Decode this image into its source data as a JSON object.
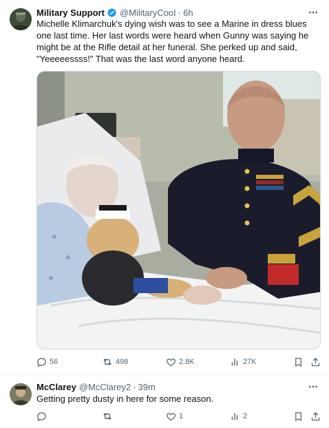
{
  "tweet": {
    "display_name": "Military Support",
    "handle": "@MilitaryCooI",
    "dot": "·",
    "time": "6h",
    "text": "Michelle Klimarchuk's dying wish was to see a Marine in dress blues one last time. Her last words were heard when Gunny was saying he might be at the Rifle detail at her funeral. She perked up and said, \"Yeeeeessss!\" That was the last word anyone heard.",
    "media_icon": "photo",
    "stats": {
      "replies": "56",
      "retweets": "498",
      "likes": "2.8K",
      "views": "27K"
    }
  },
  "reply": {
    "display_name": "McClarey",
    "handle": "@McClarey2",
    "dot": "·",
    "time": "39m",
    "text": "Getting pretty dusty in here for some reason.",
    "stats": {
      "replies": "",
      "retweets": "",
      "likes": "1",
      "views": "2"
    }
  },
  "colors": {
    "verified": "#1d9bf0",
    "muted": "#536471",
    "text": "#0f1419"
  },
  "icons": [
    "more-icon",
    "verified-badge-icon",
    "reply-icon",
    "retweet-icon",
    "like-icon",
    "views-icon",
    "bookmark-icon",
    "share-icon"
  ]
}
